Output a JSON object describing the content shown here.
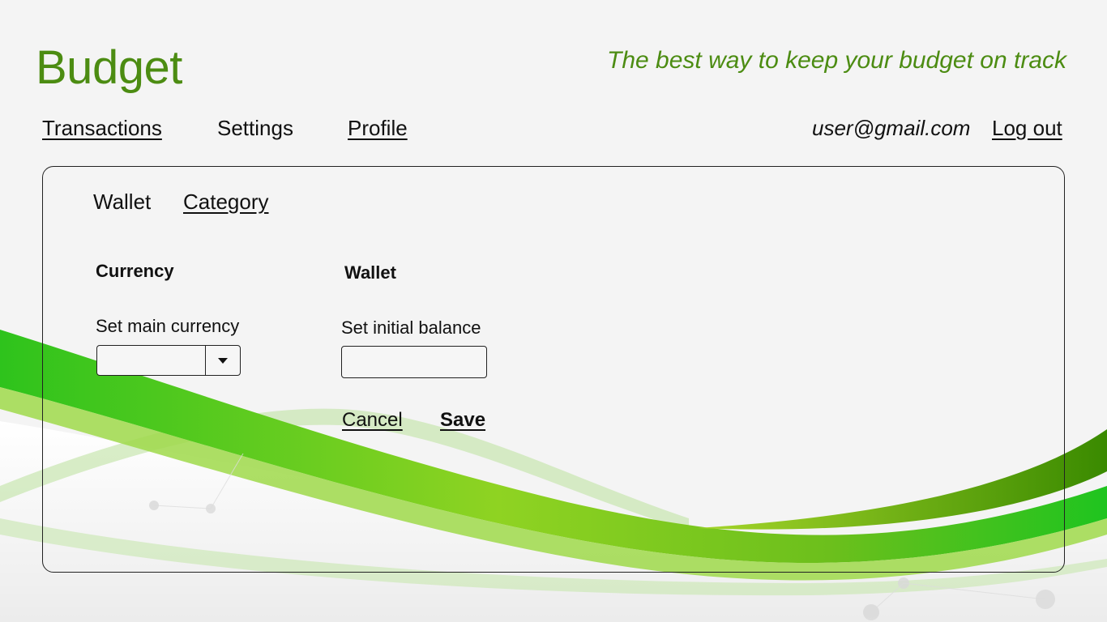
{
  "header": {
    "app_title": "Budget",
    "tagline": "The best way to keep your budget on track"
  },
  "nav": {
    "items": [
      {
        "label": "Transactions"
      },
      {
        "label": "Settings"
      },
      {
        "label": "Profile"
      }
    ],
    "user_email": "user@gmail.com",
    "logout_label": "Log out"
  },
  "settings": {
    "tabs": [
      {
        "label": "Wallet"
      },
      {
        "label": "Category"
      }
    ],
    "currency": {
      "heading": "Currency",
      "label": "Set main currency",
      "selected_value": ""
    },
    "wallet": {
      "heading": "Wallet",
      "label": "Set initial balance",
      "value": ""
    },
    "actions": {
      "cancel_label": "Cancel",
      "save_label": "Save"
    }
  },
  "colors": {
    "brand_green": "#4c8c12",
    "wave_green_bright": "#3cc51c",
    "wave_green_lime": "#8fd322",
    "wave_green_dark": "#3f8a00"
  }
}
